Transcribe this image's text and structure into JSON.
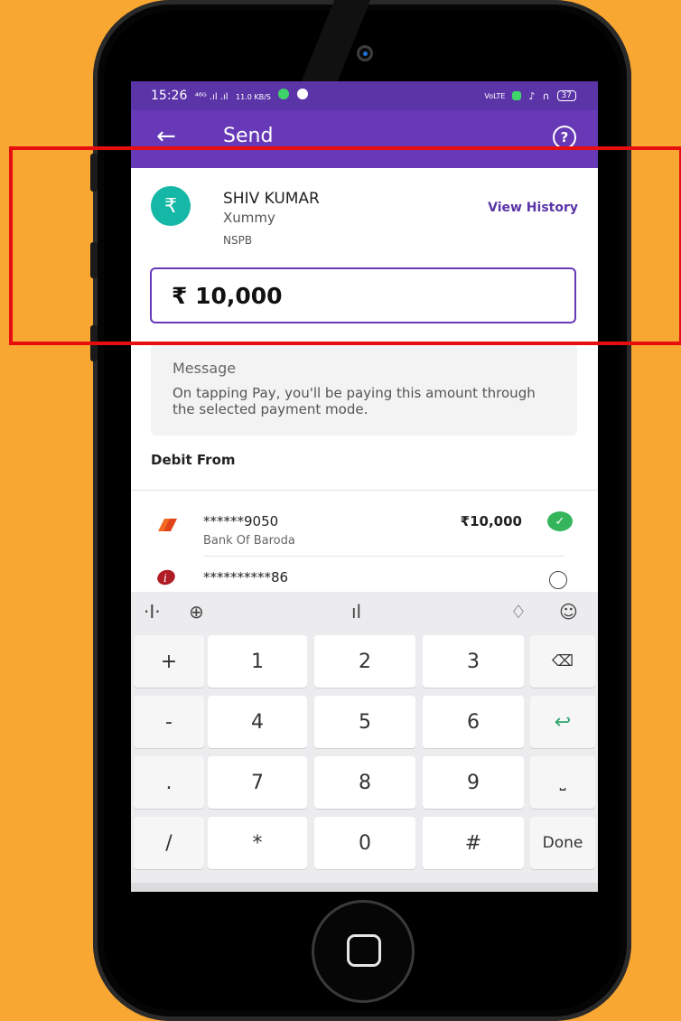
{
  "status": {
    "time": "15:26",
    "signal": "⁴⁶ᴳ .ıl .ıl",
    "speed": "11.0 KB/S",
    "network": "VoLTE",
    "battery": "37"
  },
  "appbar": {
    "title": "Send",
    "back": "←",
    "help": "?"
  },
  "payee": {
    "avatar_symbol": "₹",
    "name": "SHIV KUMAR",
    "subtitle": "Xummy",
    "bank": "NSPB",
    "history_link": "View History"
  },
  "amount": {
    "value": "₹ 10,000"
  },
  "message": {
    "label": "Message",
    "hint": "On tapping Pay, you'll be paying this amount through the selected payment mode."
  },
  "debit": {
    "heading": "Debit From",
    "accounts": [
      {
        "number": "******9050",
        "bank": "Bank Of Baroda",
        "balance": "₹10,000",
        "selected": true
      },
      {
        "number": "**********86",
        "bank": "",
        "balance": "",
        "selected": false
      }
    ]
  },
  "keyboard": {
    "rows": [
      [
        "+",
        "1",
        "2",
        "3",
        "⌫"
      ],
      [
        "-",
        "4",
        "5",
        "6",
        "↩"
      ],
      [
        ".",
        "7",
        "8",
        "9",
        "⎵"
      ],
      [
        "/",
        "*",
        "0",
        "#",
        "Done"
      ]
    ]
  },
  "colors": {
    "background": "#F8A733",
    "brand": "#6739b7",
    "status_bar": "#5b35a8",
    "highlight": "#e80e0e",
    "success": "#34b55b"
  }
}
